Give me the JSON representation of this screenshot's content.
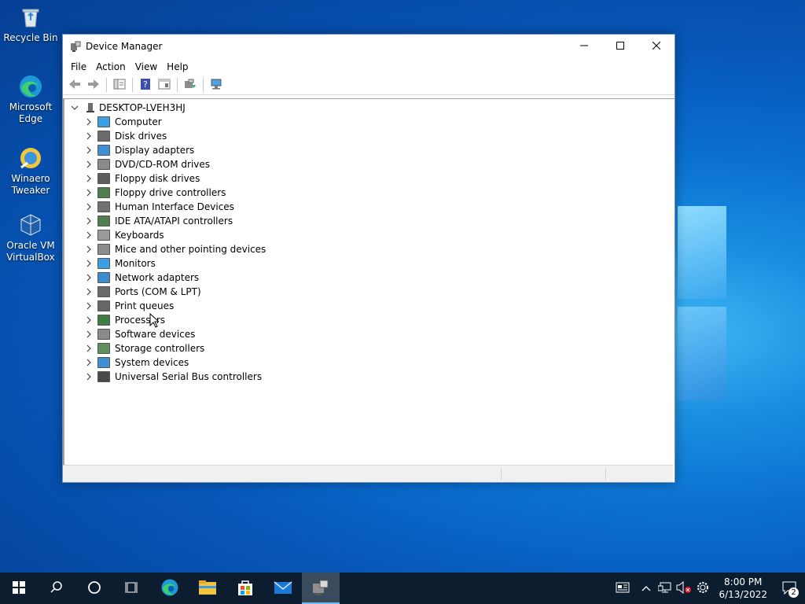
{
  "desktop": {
    "icons": [
      {
        "label_lines": [
          "Recycle Bin"
        ],
        "icon": "recycle-bin-icon"
      },
      {
        "label_lines": [
          "Microsoft",
          "Edge"
        ],
        "icon": "edge-icon"
      },
      {
        "label_lines": [
          "Winaero",
          "Tweaker"
        ],
        "icon": "winaero-tweaker-icon"
      },
      {
        "label_lines": [
          "Oracle VM",
          "VirtualBox"
        ],
        "icon": "virtualbox-icon"
      }
    ]
  },
  "window": {
    "title": "Device Manager",
    "controls": {
      "minimize": "minimize-icon",
      "maximize": "maximize-icon",
      "close": "close-icon"
    },
    "menu": [
      "File",
      "Action",
      "View",
      "Help"
    ],
    "toolbar": [
      "back-arrow-icon",
      "forward-arrow-icon",
      "console-tree-icon",
      "help-icon",
      "properties-icon",
      "update-driver-icon",
      "scan-hardware-icon"
    ],
    "tree": {
      "root": "DESKTOP-LVEH3HJ",
      "categories": [
        {
          "label": "Computer",
          "icon": "computer-icon",
          "color": "#3b9fe3"
        },
        {
          "label": "Disk drives",
          "icon": "disk-drive-icon",
          "color": "#6b6b6b"
        },
        {
          "label": "Display adapters",
          "icon": "display-adapter-icon",
          "color": "#3f8fd6"
        },
        {
          "label": "DVD/CD-ROM drives",
          "icon": "dvd-drive-icon",
          "color": "#8a8a8a"
        },
        {
          "label": "Floppy disk drives",
          "icon": "floppy-disk-icon",
          "color": "#5d5d5d"
        },
        {
          "label": "Floppy drive controllers",
          "icon": "floppy-controller-icon",
          "color": "#4e7f4e"
        },
        {
          "label": "Human Interface Devices",
          "icon": "hid-icon",
          "color": "#707070"
        },
        {
          "label": "IDE ATA/ATAPI controllers",
          "icon": "ide-controller-icon",
          "color": "#4e7f4e"
        },
        {
          "label": "Keyboards",
          "icon": "keyboard-icon",
          "color": "#9a9a9a"
        },
        {
          "label": "Mice and other pointing devices",
          "icon": "mouse-icon",
          "color": "#8c8c8c"
        },
        {
          "label": "Monitors",
          "icon": "monitor-icon",
          "color": "#3b9fe3"
        },
        {
          "label": "Network adapters",
          "icon": "network-adapter-icon",
          "color": "#3a8ed0"
        },
        {
          "label": "Ports (COM & LPT)",
          "icon": "ports-icon",
          "color": "#6a6a6a"
        },
        {
          "label": "Print queues",
          "icon": "printer-icon",
          "color": "#666666"
        },
        {
          "label": "Processors",
          "icon": "processor-icon",
          "color": "#3f7f3f"
        },
        {
          "label": "Software devices",
          "icon": "software-device-icon",
          "color": "#8a8a8a"
        },
        {
          "label": "Storage controllers",
          "icon": "storage-controller-icon",
          "color": "#5f8f5f"
        },
        {
          "label": "System devices",
          "icon": "system-device-icon",
          "color": "#3b8fd6"
        },
        {
          "label": "Universal Serial Bus controllers",
          "icon": "usb-icon",
          "color": "#4a4a4a"
        }
      ]
    }
  },
  "taskbar": {
    "items": [
      {
        "icon": "start-icon"
      },
      {
        "icon": "search-icon"
      },
      {
        "icon": "cortana-icon"
      },
      {
        "icon": "task-view-icon"
      },
      {
        "icon": "edge-icon"
      },
      {
        "icon": "file-explorer-icon"
      },
      {
        "icon": "store-icon"
      },
      {
        "icon": "mail-icon"
      },
      {
        "icon": "device-manager-icon",
        "active": true
      }
    ],
    "tray": {
      "icons": [
        "news-icon",
        "chevron-up-icon",
        "network-icon",
        "volume-muted-icon",
        "settings-gear-icon"
      ],
      "time": "8:00 PM",
      "date": "6/13/2022",
      "notification_count": "2"
    }
  },
  "colors": {
    "accent": "#0078d7",
    "taskbar": "#0c1d2f",
    "active_task_indicator": "#76b9ed"
  }
}
